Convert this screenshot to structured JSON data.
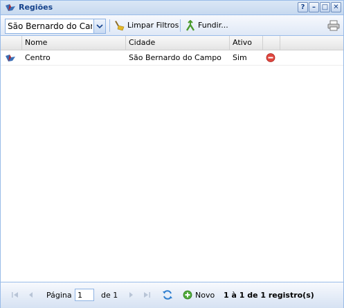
{
  "window": {
    "title": "Regiões",
    "tools": [
      "?",
      "–",
      "□",
      "✕"
    ]
  },
  "toolbar": {
    "filter_value": "São Bernardo do Campo",
    "clear_filters_label": "Limpar Filtros",
    "merge_label": "Fundir..."
  },
  "grid": {
    "columns": [
      "Nome",
      "Cidade",
      "Ativo"
    ],
    "rows": [
      {
        "nome": "Centro",
        "cidade": "São Bernardo do Campo",
        "ativo": "Sim"
      }
    ]
  },
  "pager": {
    "page_label": "Página",
    "page_value": "1",
    "of_label": "de 1",
    "new_label": "Novo",
    "summary": "1 à 1 de 1 registro(s)"
  },
  "colors": {
    "accent": "#15428b",
    "border": "#99bbe8",
    "panel": "#dfe8f6"
  }
}
